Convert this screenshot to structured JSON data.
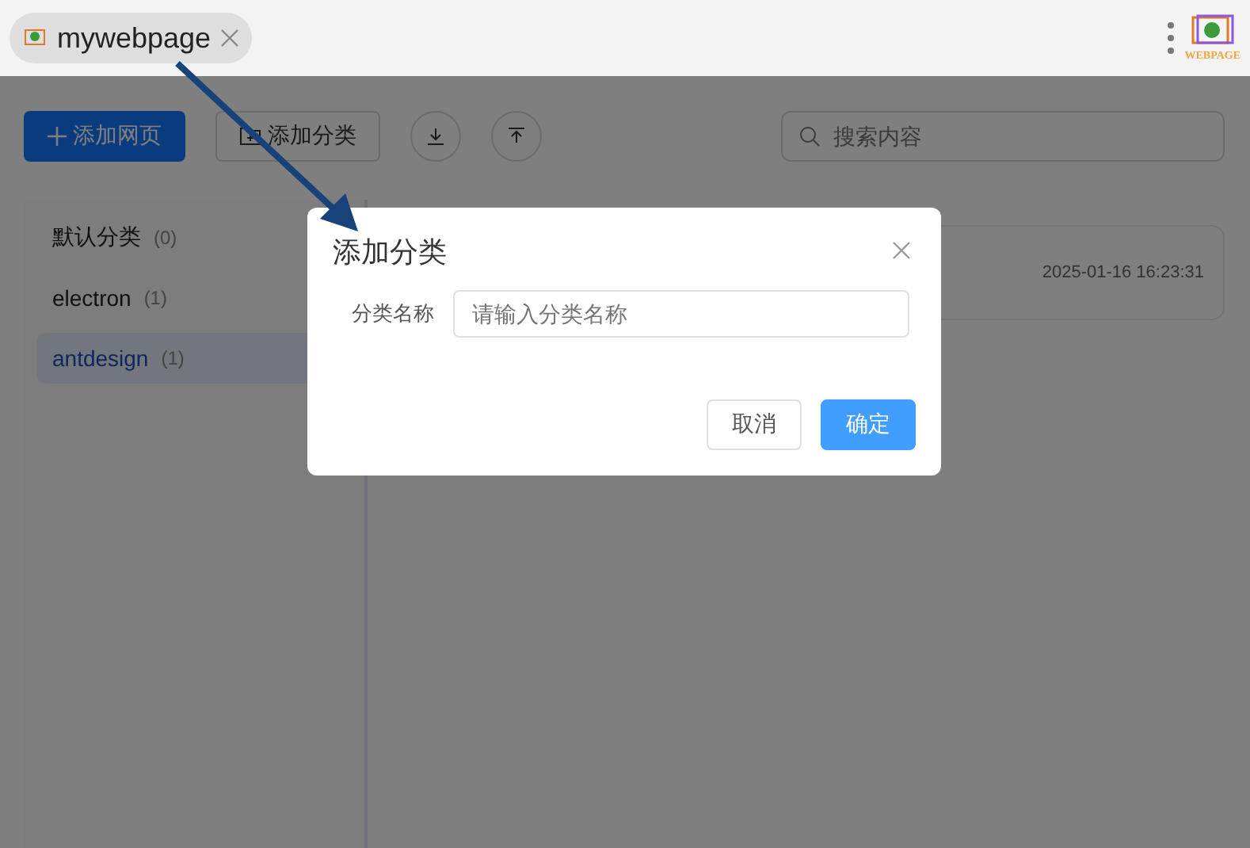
{
  "tab": {
    "title": "mywebpage"
  },
  "logo": {
    "text": "WEBPAGE"
  },
  "toolbar": {
    "add_page": "添加网页",
    "add_category": "添加分类",
    "search": {
      "placeholder": "搜索内容"
    }
  },
  "sidebar": {
    "items": [
      {
        "name": "默认分类",
        "count": "(0)",
        "selected": false
      },
      {
        "name": "electron",
        "count": "(1)",
        "selected": false
      },
      {
        "name": "antdesign",
        "count": "(1)",
        "selected": true
      }
    ]
  },
  "cards": [
    {
      "time": "2025-01-16 16:23:31"
    }
  ],
  "dialog": {
    "title": "添加分类",
    "field_label": "分类名称",
    "field": {
      "placeholder": "请输入分类名称"
    },
    "buttons": [
      {
        "label": "取消",
        "kind": "default"
      },
      {
        "label": "确定",
        "kind": "primary"
      }
    ]
  }
}
